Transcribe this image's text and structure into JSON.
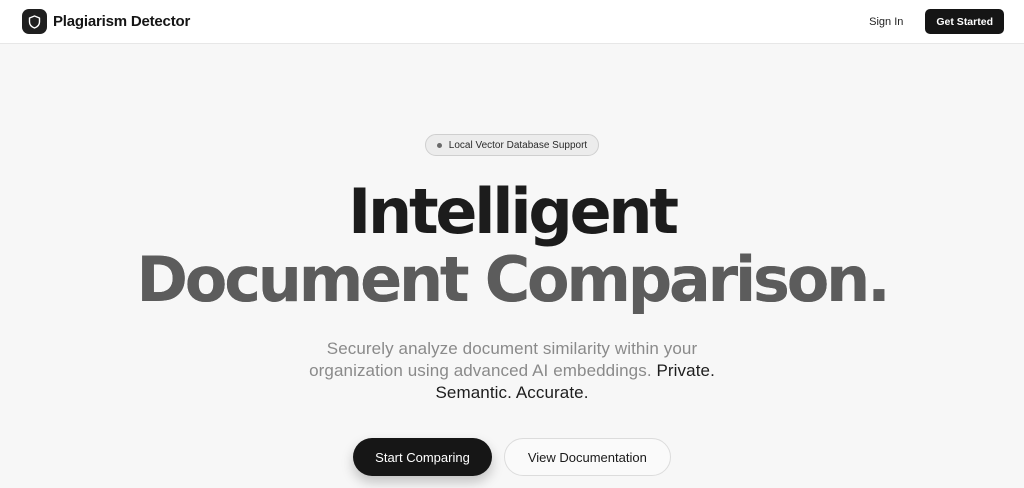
{
  "navbar": {
    "brand_name": "Plagiarism Detector",
    "logo_icon": "shield-icon",
    "sign_in_label": "Sign In",
    "get_started_label": "Get Started"
  },
  "hero": {
    "badge_text": "Local Vector Database Support",
    "headline_line1": "Intelligent",
    "headline_line2": "Document Comparison.",
    "subtext_regular": "Securely analyze document similarity within your organization using advanced AI embeddings. ",
    "subtext_strong": "Private. Semantic. Accurate.",
    "primary_cta": "Start Comparing",
    "secondary_cta": "View Documentation"
  },
  "colors": {
    "background": "#f7f7f7",
    "primary": "#161616",
    "muted_text": "#8a8a8a"
  }
}
